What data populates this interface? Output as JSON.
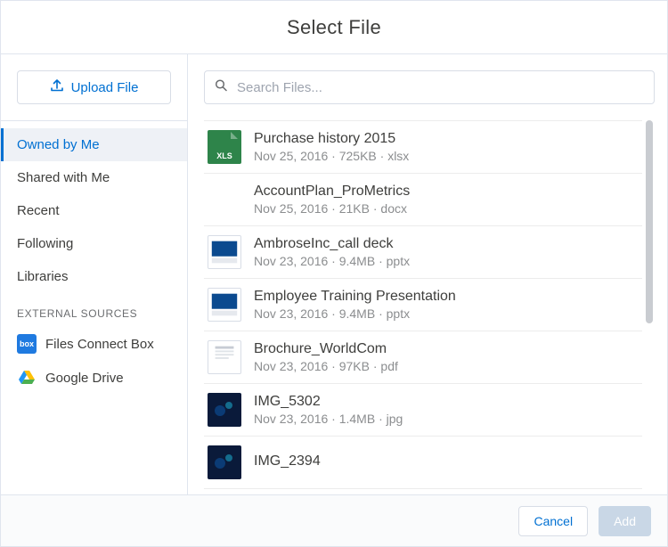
{
  "header": {
    "title": "Select File"
  },
  "upload": {
    "label": "Upload File"
  },
  "nav": {
    "items": [
      {
        "label": "Owned by Me",
        "selected": true
      },
      {
        "label": "Shared with Me",
        "selected": false
      },
      {
        "label": "Recent",
        "selected": false
      },
      {
        "label": "Following",
        "selected": false
      },
      {
        "label": "Libraries",
        "selected": false
      }
    ]
  },
  "external": {
    "header": "EXTERNAL SOURCES",
    "items": [
      {
        "label": "Files Connect Box",
        "icon": "box"
      },
      {
        "label": "Google Drive",
        "icon": "gdrive"
      }
    ]
  },
  "search": {
    "placeholder": "Search Files..."
  },
  "files": [
    {
      "name": "Purchase history 2015",
      "date": "Nov 25, 2016",
      "size": "725KB",
      "ext": "xlsx",
      "thumb": "xls"
    },
    {
      "name": "AccountPlan_ProMetrics",
      "date": "Nov 25, 2016",
      "size": "21KB",
      "ext": "docx",
      "thumb": "none"
    },
    {
      "name": "AmbroseInc_call deck",
      "date": "Nov 23, 2016",
      "size": "9.4MB",
      "ext": "pptx",
      "thumb": "pptx"
    },
    {
      "name": "Employee Training Presentation",
      "date": "Nov 23, 2016",
      "size": "9.4MB",
      "ext": "pptx",
      "thumb": "pptx"
    },
    {
      "name": "Brochure_WorldCom",
      "date": "Nov 23, 2016",
      "size": "97KB",
      "ext": "pdf",
      "thumb": "pdf"
    },
    {
      "name": "IMG_5302",
      "date": "Nov 23, 2016",
      "size": "1.4MB",
      "ext": "jpg",
      "thumb": "jpg"
    },
    {
      "name": "IMG_2394",
      "date": "",
      "size": "",
      "ext": "",
      "thumb": "jpg"
    }
  ],
  "footer": {
    "cancel": "Cancel",
    "add": "Add"
  },
  "colors": {
    "accent": "#0070d2",
    "xls": "#2e844a",
    "box": "#1f7ae0",
    "thumbBlue1": "#0b4a8f",
    "thumbBlue2": "#0a1a3a"
  }
}
